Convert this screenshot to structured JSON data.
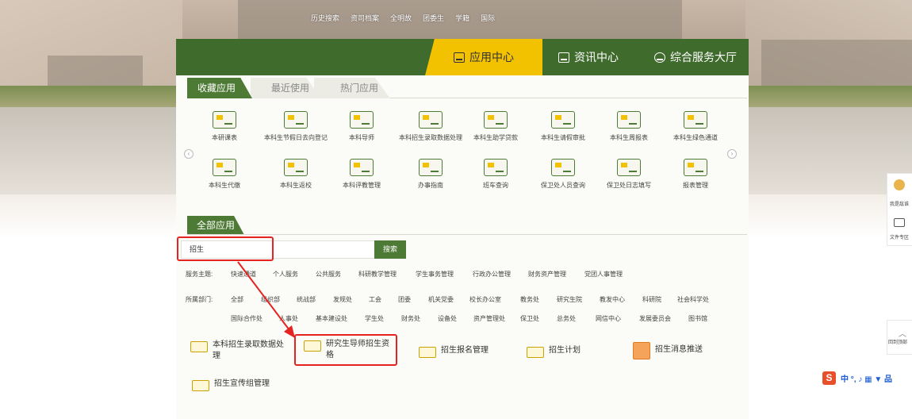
{
  "top_links": [
    "历史搜索",
    "资司档案",
    "全明故",
    "团委生",
    "学籍",
    "国际"
  ],
  "main_tabs": {
    "app_center": "应用中心",
    "news_center": "资讯中心",
    "service_hall": "综合服务大厅"
  },
  "sub_tabs": [
    "收藏应用",
    "最近使用",
    "热门应用"
  ],
  "favorite_apps": [
    "本研课表",
    "本科生节假日去向登记",
    "本科导师",
    "本科招生录取数据处理",
    "本科生助学贷款",
    "本科生请假审批",
    "本科生周报表",
    "本科生绿色通道",
    "本科生代缴",
    "本科生返校",
    "本科评教管理",
    "办事指南",
    "班车查询",
    "保卫处人员查询",
    "保卫处日志填写",
    "报表管理"
  ],
  "nav_prev": "‹",
  "nav_next": "›",
  "all_apps": {
    "tab": "全部应用",
    "search_value": "招生",
    "search_button": "搜索",
    "service_label": "服务主题:",
    "service_topics": [
      "快速通道",
      "个人服务",
      "公共服务",
      "科研教学管理",
      "学生事务管理",
      "行政办公管理",
      "财务资产管理",
      "党团人事管理"
    ],
    "dept_label": "所属部门:",
    "departments_row1": [
      "全部",
      "组织部",
      "统战部",
      "发规处",
      "工会",
      "团委",
      "机关党委",
      "校长办公室",
      "教务处",
      "研究生院",
      "教发中心",
      "科研院",
      "社会科学处"
    ],
    "departments_row2": [
      "国际合作处",
      "人事处",
      "基本建设处",
      "学生处",
      "财务处",
      "设备处",
      "资产管理处",
      "保卫处",
      "总务处",
      "网信中心",
      "发展委员会",
      "图书馆"
    ]
  },
  "results": [
    "本科招生录取数据处理",
    "研究生导师招生资格",
    "招生报名管理",
    "招生计划",
    "招生消息推送",
    "招生宣传组管理"
  ],
  "side_widget": {
    "item1": "我是敌谁",
    "item2": "文件专区",
    "back_top": "回到顶部"
  },
  "ime": {
    "logo": "S",
    "glyphs": "中 °, ♪ ▦ ▼ 品"
  },
  "colors": {
    "green": "#3f6b2c",
    "yellow": "#f2c200",
    "annotation_red": "#e52421"
  }
}
